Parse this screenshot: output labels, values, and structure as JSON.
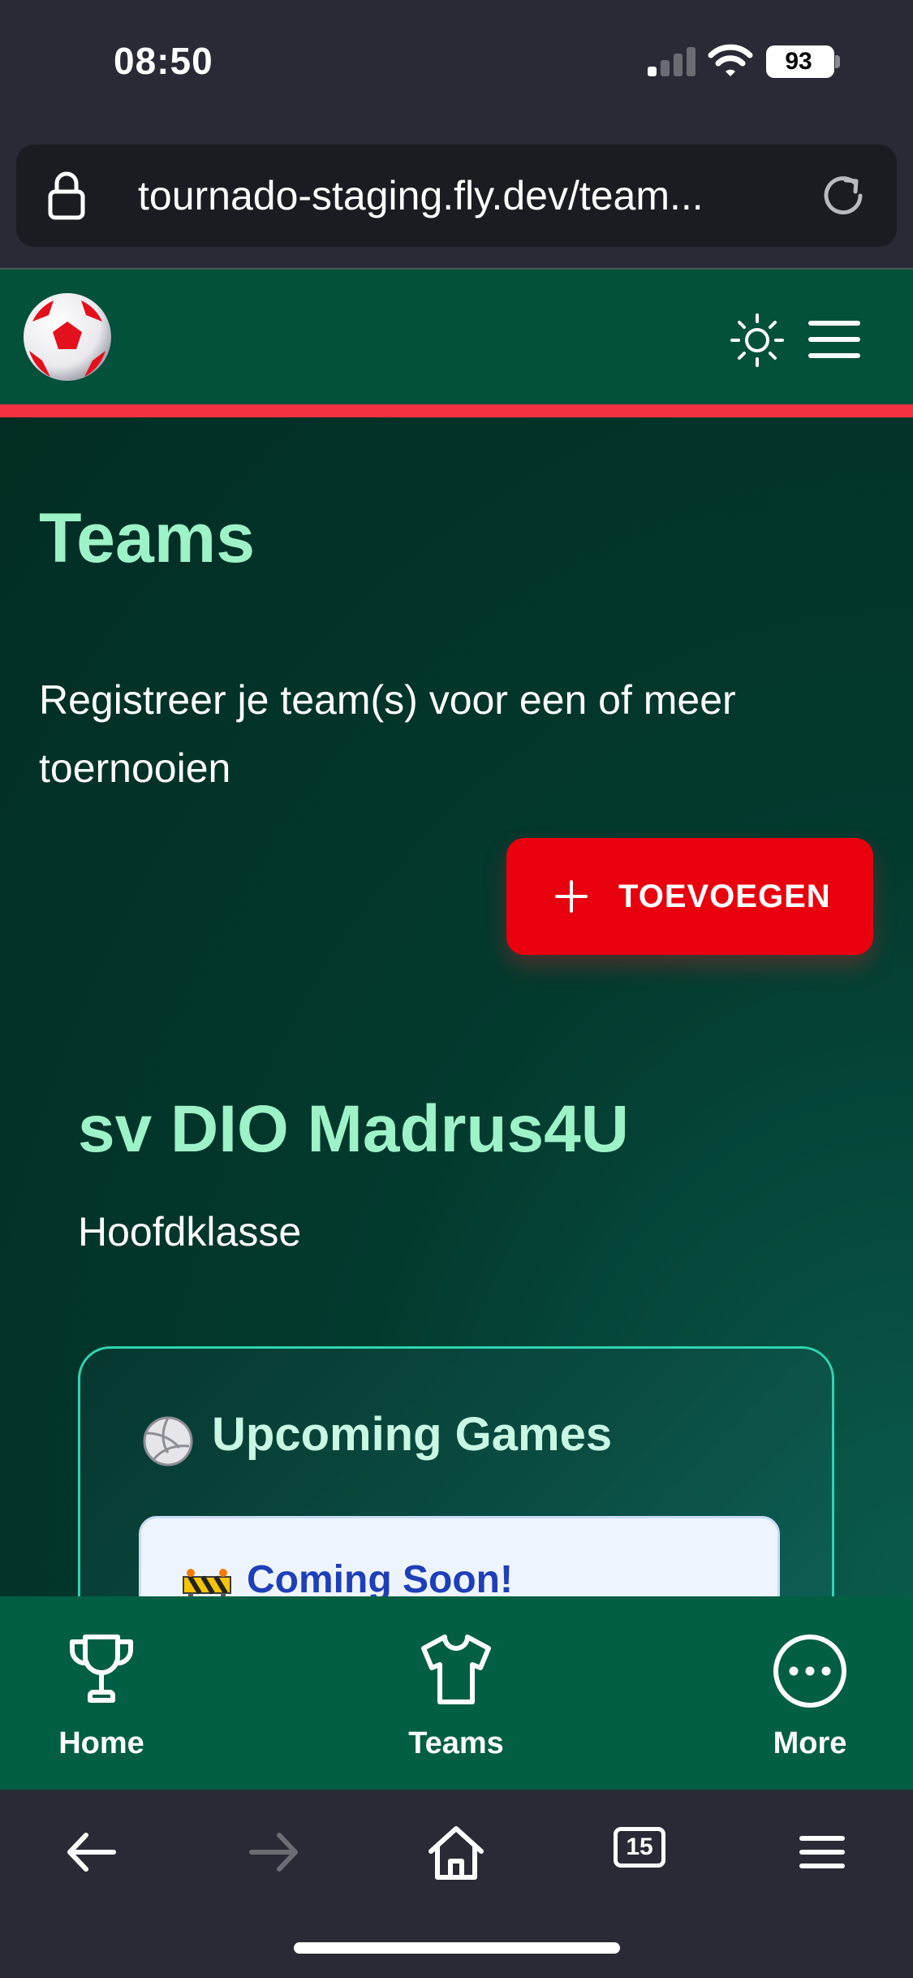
{
  "status_bar": {
    "time": "08:50",
    "battery": "93"
  },
  "browser": {
    "url": "tournado-staging.fly.dev/team...",
    "tab_count": "15"
  },
  "header": {
    "logo": "soccer-ball-logo",
    "theme_icon": "sun-icon",
    "menu_icon": "hamburger-icon"
  },
  "page": {
    "title": "Teams",
    "subtitle": "Registreer je team(s) voor een of meer toernooien",
    "add_button_label": "TOEVOEGEN"
  },
  "team": {
    "name": "sv DIO Madrus4U",
    "class": "Hoofdklasse",
    "upcoming_title": "Upcoming Games",
    "coming_soon": "Coming Soon!"
  },
  "nav": {
    "items": [
      {
        "label": "Home",
        "icon": "trophy-icon"
      },
      {
        "label": "Teams",
        "icon": "shirt-icon"
      },
      {
        "label": "More",
        "icon": "more-icon"
      }
    ]
  },
  "colors": {
    "header_bg": "#03503b",
    "accent": "#f53141",
    "title": "#9ef2c8",
    "button": "#e8000f",
    "nav_bg": "#025f43"
  }
}
